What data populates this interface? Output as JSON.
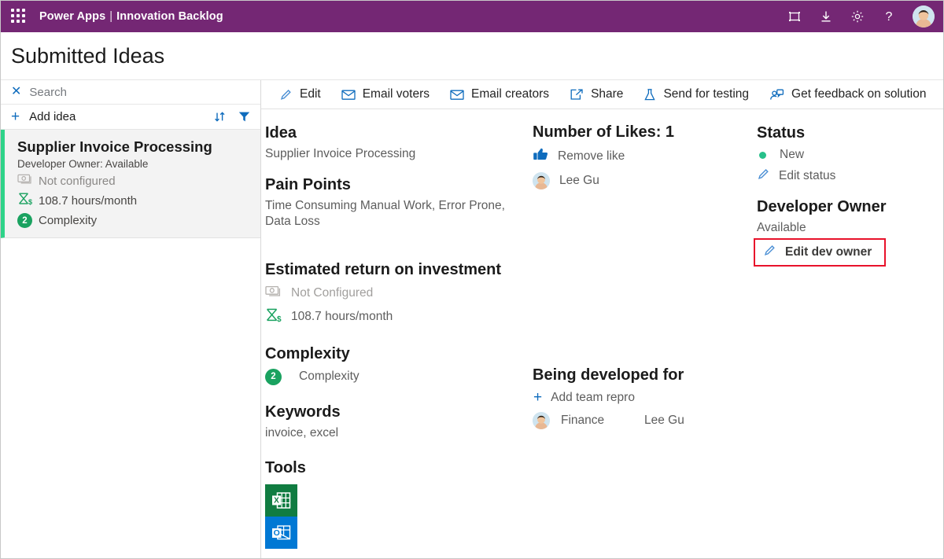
{
  "topbar": {
    "waffle_label": "App launcher",
    "brand_product": "Power Apps",
    "brand_separator": "|",
    "brand_app": "Innovation Backlog",
    "icons": [
      {
        "name": "fit-to-screen-icon",
        "label": "Fit to screen"
      },
      {
        "name": "download-icon",
        "label": "Download"
      },
      {
        "name": "gear-icon",
        "label": "Settings"
      },
      {
        "name": "help-icon",
        "label": "?"
      }
    ],
    "avatar_label": "Lee Gu"
  },
  "page": {
    "title": "Submitted Ideas"
  },
  "sidebar": {
    "search": {
      "placeholder": "Search",
      "clear_label": "Clear search"
    },
    "add_idea": {
      "label": "Add idea"
    },
    "tools": [
      {
        "name": "sort-icon",
        "label": "Sort"
      },
      {
        "name": "filter-icon",
        "label": "Filter"
      }
    ],
    "cards": [
      {
        "title": "Supplier Invoice Processing",
        "subtitle": "Developer Owner: Available",
        "roi_money": "Not configured",
        "roi_hours": "108.7 hours/month",
        "complexity_value": "2",
        "complexity_label": "Complexity",
        "accent_color": "#2ed389",
        "selected": true
      }
    ]
  },
  "commandbar": {
    "items": [
      {
        "icon": "pencil-icon",
        "label": "Edit"
      },
      {
        "icon": "mail-icon",
        "label": "Email voters"
      },
      {
        "icon": "mail-icon",
        "label": "Email creators"
      },
      {
        "icon": "share-icon",
        "label": "Share"
      },
      {
        "icon": "beaker-icon",
        "label": "Send for testing"
      },
      {
        "icon": "feedback-person-icon",
        "label": "Get feedback on solution"
      }
    ]
  },
  "detail": {
    "idea": {
      "heading": "Idea",
      "value": "Supplier Invoice Processing"
    },
    "pain_points": {
      "heading": "Pain Points",
      "value": "Time Consuming Manual Work, Error Prone, Data Loss"
    },
    "roi": {
      "heading": "Estimated return on investment",
      "money_label": "Not Configured",
      "hours_label": "108.7 hours/month"
    },
    "complexity": {
      "heading": "Complexity",
      "value": "2",
      "label": "Complexity"
    },
    "keywords": {
      "heading": "Keywords",
      "value": "invoice, excel"
    },
    "tools": {
      "heading": "Tools",
      "items": [
        {
          "name": "excel-icon",
          "label": "Excel",
          "color": "#107c41"
        },
        {
          "name": "outlook-icon",
          "label": "Outlook",
          "color": "#0078d4"
        }
      ]
    }
  },
  "likes": {
    "heading": "Number of Likes: 1",
    "count": "1",
    "action_label": "Remove like",
    "voters": [
      {
        "name": "Lee Gu"
      }
    ]
  },
  "developed_for": {
    "heading": "Being developed for",
    "add_label": "Add team repro",
    "teams": [
      {
        "team": "Finance",
        "owner": "Lee Gu"
      }
    ]
  },
  "status": {
    "heading": "Status",
    "value": "New",
    "value_color": "#27c08a",
    "edit_label": "Edit status"
  },
  "developer_owner": {
    "heading": "Developer Owner",
    "value": "Available",
    "edit_label": "Edit dev owner",
    "highlight_color": "#e8122b"
  }
}
